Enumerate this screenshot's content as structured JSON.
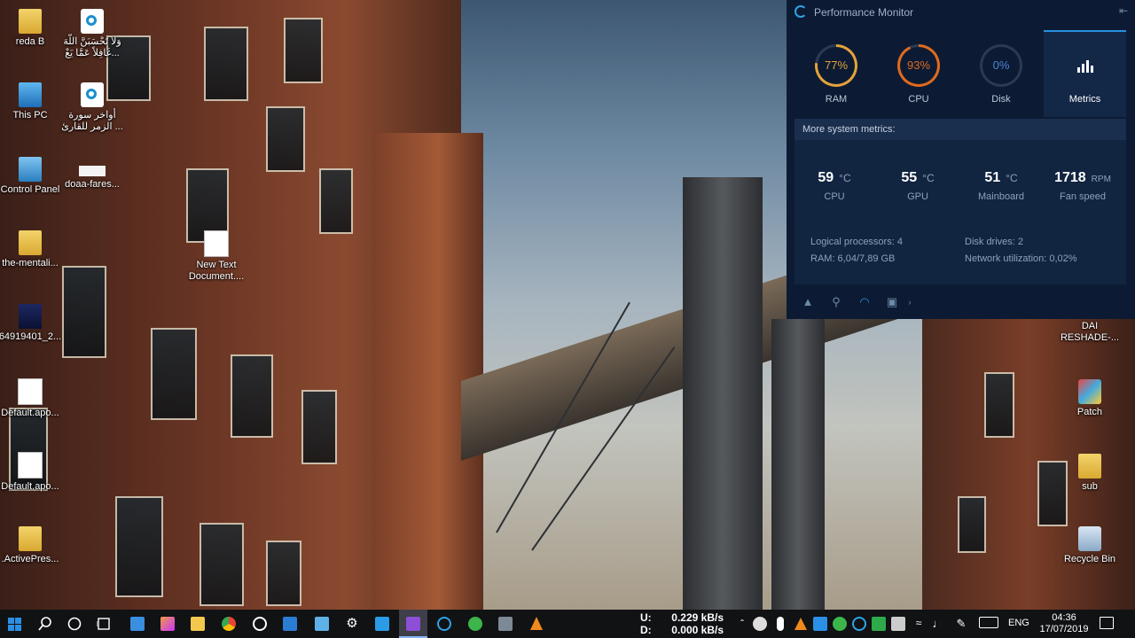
{
  "desktop_icons": [
    {
      "label": "reda B"
    },
    {
      "label": "وَلاَ تَحْسَبَنَّ اللّهَ غَافِلاً عَمَّا يَعْ..."
    },
    {
      "label": "This PC"
    },
    {
      "label": "أواخر سورة الزمر للقارئ ..."
    },
    {
      "label": "Control Panel"
    },
    {
      "label": "doaa-fares..."
    },
    {
      "label": "the-mentali..."
    },
    {
      "label": "New Text Document...."
    },
    {
      "label": "64919401_2..."
    },
    {
      "label": "Default.apo..."
    },
    {
      "label": "Default.apo..."
    },
    {
      "label": ".ActivePres..."
    },
    {
      "label": "DAI RESHADE-..."
    },
    {
      "label": "Patch"
    },
    {
      "label": "sub"
    },
    {
      "label": "Recycle Bin"
    }
  ],
  "perf_monitor": {
    "title": "Performance Monitor",
    "gauges": [
      {
        "value": "77%",
        "label": "RAM",
        "percent": 77,
        "color": "#e3a23b"
      },
      {
        "value": "93%",
        "label": "CPU",
        "percent": 93,
        "color": "#e06a1e"
      },
      {
        "value": "0%",
        "label": "Disk",
        "percent": 0,
        "color": "#4d83d8"
      }
    ],
    "metrics_tab": "Metrics",
    "more_label": "More system metrics:",
    "stats": [
      {
        "value": "59",
        "unit": "°C",
        "label": "CPU"
      },
      {
        "value": "55",
        "unit": "°C",
        "label": "GPU"
      },
      {
        "value": "51",
        "unit": "°C",
        "label": "Mainboard"
      },
      {
        "value": "1718",
        "unit": "RPM",
        "label": "Fan speed"
      }
    ],
    "info": {
      "logical": "Logical processors: 4",
      "ram": "RAM: 6,04/7,89 GB",
      "disk_drives": "Disk drives: 2",
      "network": "Network utilization: 0,02%"
    }
  },
  "taskbar": {
    "net": {
      "up_key": "U:",
      "up_val": "0.229 kB/s",
      "down_key": "D:",
      "down_val": "0.000 kB/s"
    },
    "lang": "ENG",
    "time": "04:36",
    "date": "17/07/2019"
  }
}
